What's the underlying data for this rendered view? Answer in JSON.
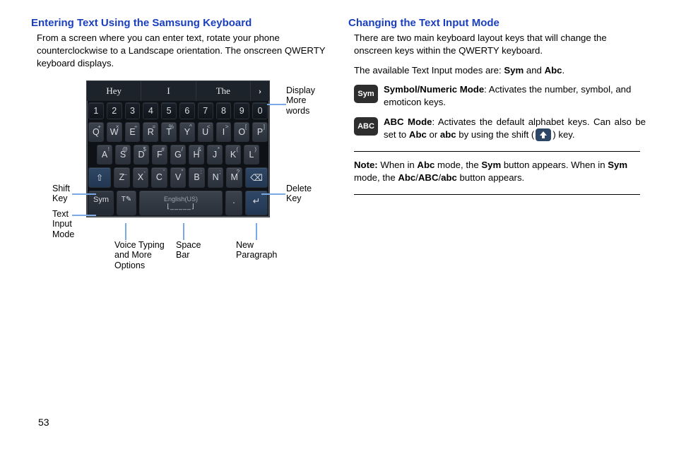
{
  "left": {
    "heading": "Entering Text Using the Samsung Keyboard",
    "para": "From a screen where you can enter text, rotate your phone counterclockwise to a Landscape orientation. The onscreen QWERTY keyboard displays."
  },
  "callouts": {
    "display_more": "Display\nMore\nwords",
    "shift_key": "Shift\nKey",
    "text_input_mode": "Text\nInput\nMode",
    "delete_key": "Delete\nKey",
    "voice_more": "Voice Typing\nand More\nOptions",
    "space_bar": "Space\nBar",
    "new_para": "New\nParagraph"
  },
  "keyboard": {
    "suggestions": [
      "Hey",
      "I",
      "The"
    ],
    "more_glyph": "›",
    "numbers": [
      "1",
      "2",
      "3",
      "4",
      "5",
      "6",
      "7",
      "8",
      "9",
      "0"
    ],
    "row_q": [
      {
        "k": "Q",
        "s": "+"
      },
      {
        "k": "W",
        "s": "×"
      },
      {
        "k": "E",
        "s": "÷"
      },
      {
        "k": "R",
        "s": "="
      },
      {
        "k": "T",
        "s": "%"
      },
      {
        "k": "Y",
        "s": "^"
      },
      {
        "k": "U",
        "s": "<"
      },
      {
        "k": "I",
        "s": ">"
      },
      {
        "k": "O",
        "s": "["
      },
      {
        "k": "P",
        "s": "]"
      }
    ],
    "row_a": [
      {
        "k": "A",
        "s": "!"
      },
      {
        "k": "S",
        "s": "@"
      },
      {
        "k": "D",
        "s": "$"
      },
      {
        "k": "F",
        "s": "#"
      },
      {
        "k": "G",
        "s": "/"
      },
      {
        "k": "H",
        "s": "&"
      },
      {
        "k": "J",
        "s": "*"
      },
      {
        "k": "K",
        "s": "("
      },
      {
        "k": "L",
        "s": ")"
      }
    ],
    "row_z": [
      {
        "k": "Z",
        "s": "_"
      },
      {
        "k": "X",
        "s": "-"
      },
      {
        "k": "C",
        "s": "'"
      },
      {
        "k": "V",
        "s": "\""
      },
      {
        "k": "B",
        "s": ":"
      },
      {
        "k": "N",
        "s": ";"
      },
      {
        "k": "M",
        "s": "?"
      }
    ],
    "sym_label": "Sym",
    "space_label": "English(US)",
    "dot_label": ".",
    "shift_glyph": "⇧",
    "del_glyph": "⌫",
    "opt_glyph": "T✎",
    "enter_glyph": "↵"
  },
  "right": {
    "heading": "Changing the Text Input Mode",
    "p1": "There are two main keyboard layout keys that will change the onscreen keys within the QWERTY keyboard.",
    "p2_a": "The available Text Input modes are: ",
    "p2_b": "Sym",
    "p2_c": " and ",
    "p2_d": "Abc",
    "p2_e": ".",
    "sym_badge": "Sym",
    "sym_title": "Symbol/Numeric Mode",
    "sym_body": ": Activates the number, symbol, and emoticon keys.",
    "abc_badge": "ABC",
    "abc_title": "ABC Mode",
    "abc_body_a": ": Activates the default alphabet keys. Can also be set to ",
    "abc_body_b": "Abc",
    "abc_body_c": " or ",
    "abc_body_d": "abc",
    "abc_body_e": " by using the shift (",
    "abc_body_f": ") key.",
    "note_label": "Note:",
    "note_a": " When in ",
    "note_b": "Abc",
    "note_c": " mode, the ",
    "note_d": "Sym",
    "note_e": " button appears. When in ",
    "note_f": "Sym",
    "note_g": " mode, the ",
    "note_h": "Abc",
    "note_i": "/",
    "note_j": "ABC",
    "note_k": "/",
    "note_l": "abc",
    "note_m": " button appears."
  },
  "page_number": "53"
}
